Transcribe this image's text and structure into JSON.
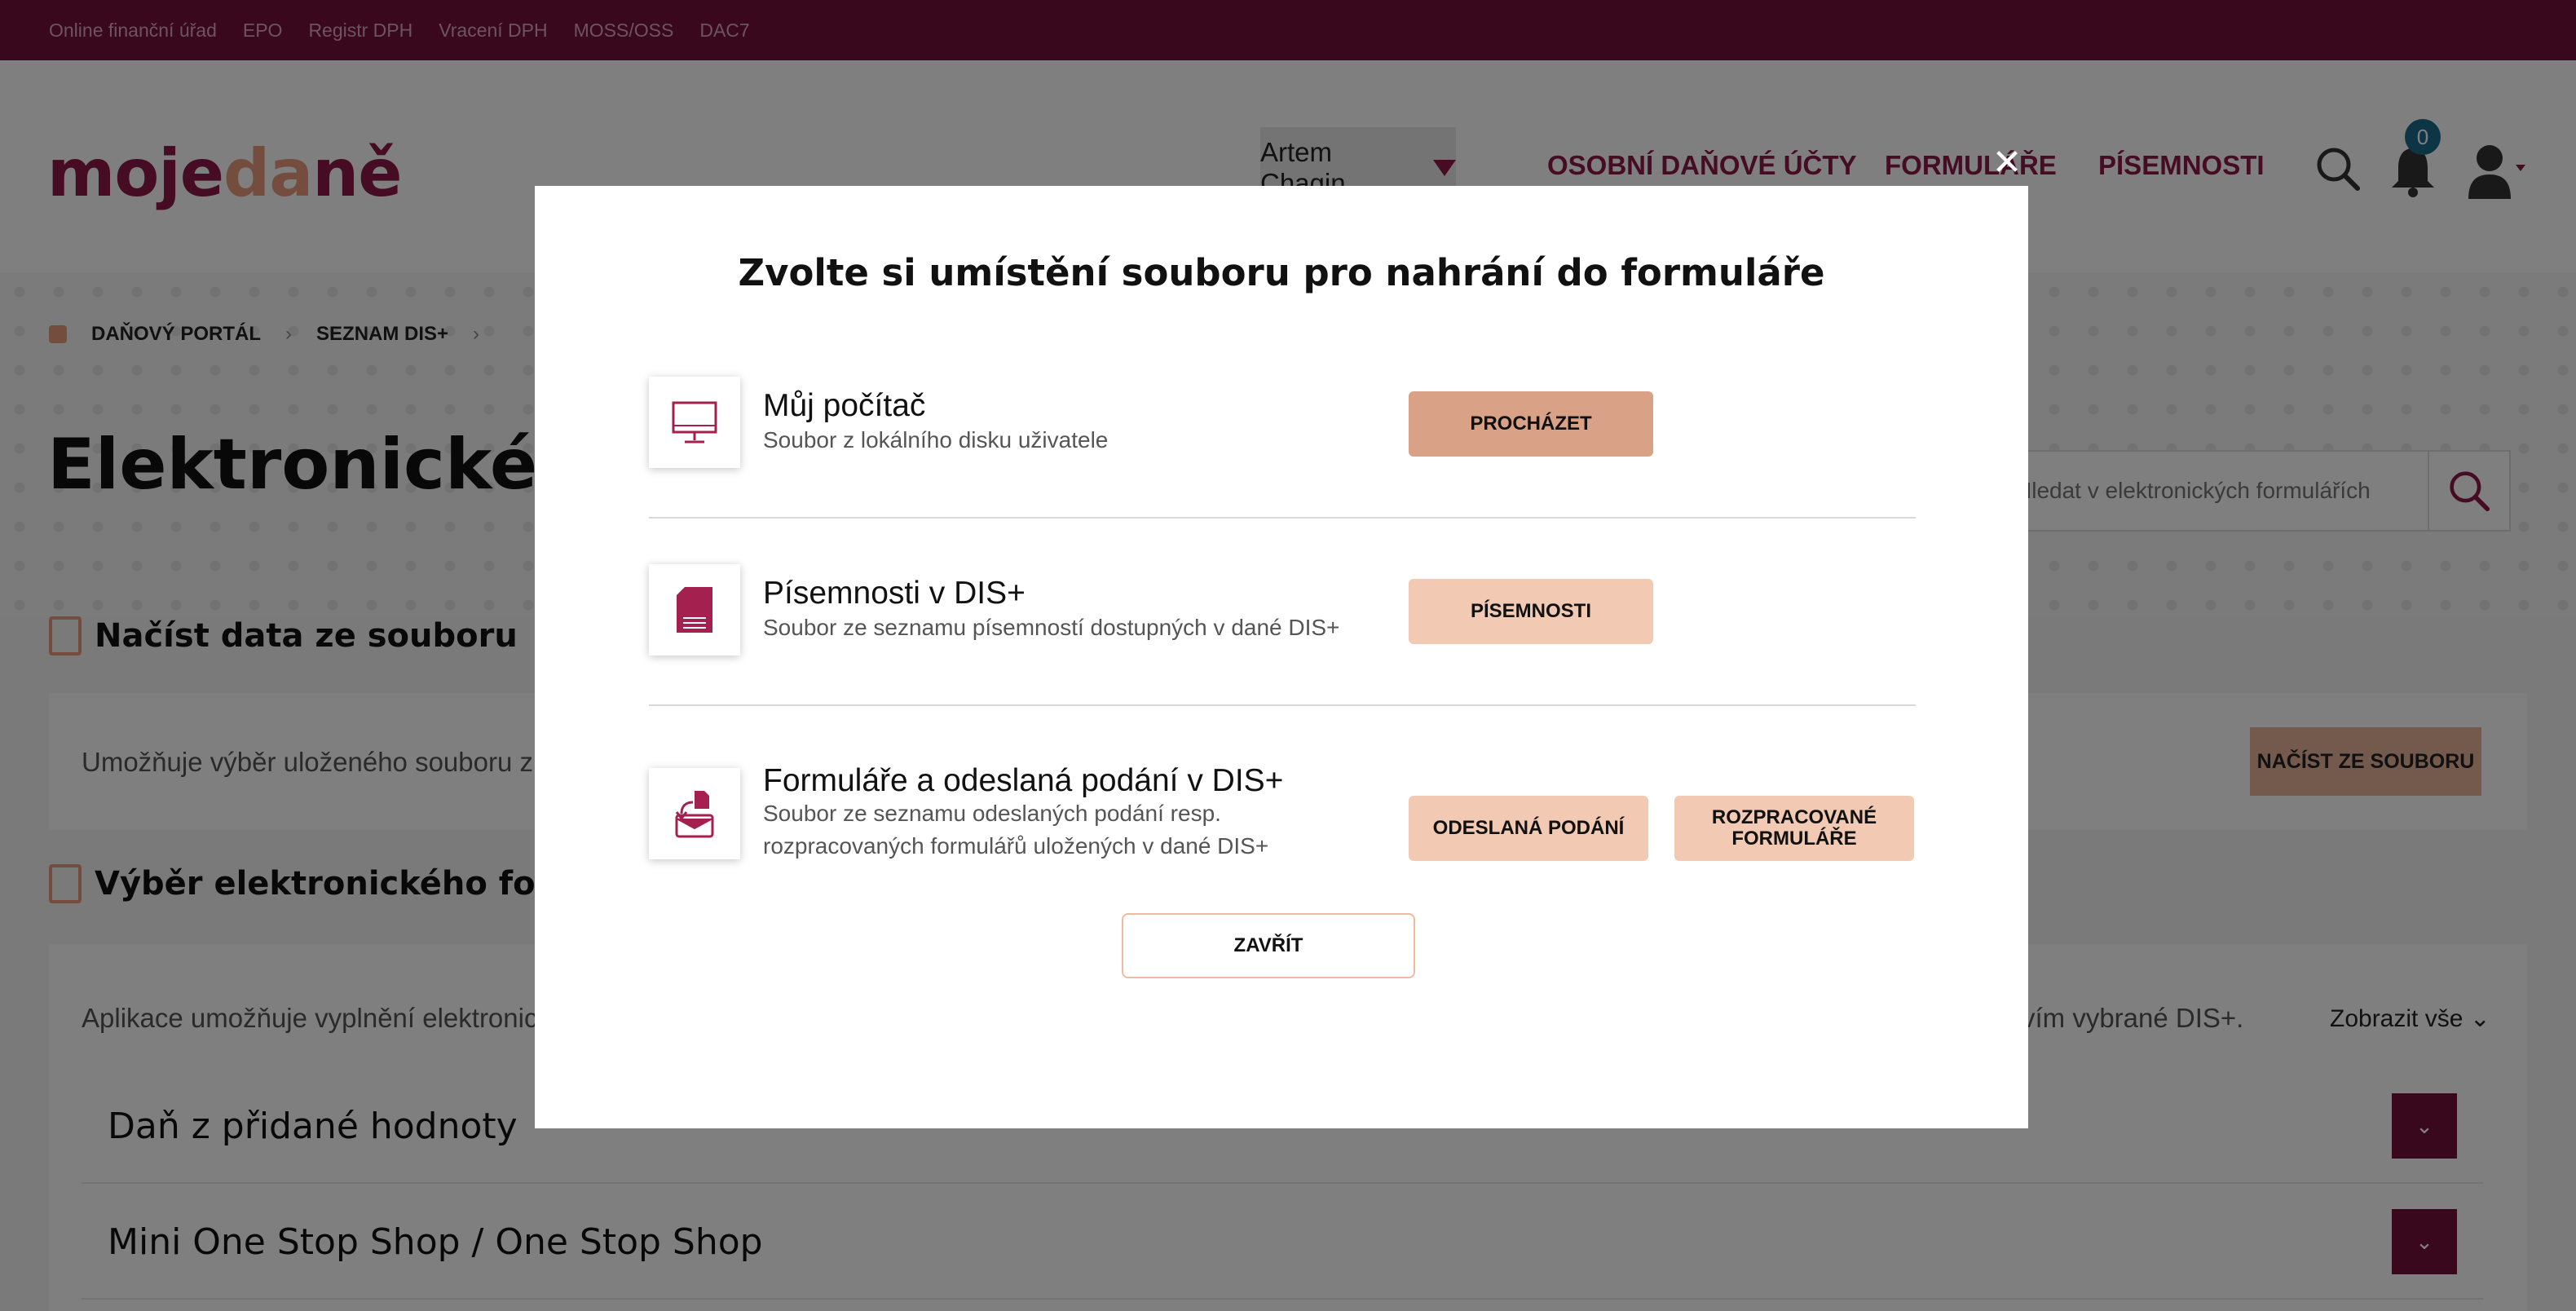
{
  "topbar": {
    "links": [
      "Online finanční úřad",
      "EPO",
      "Registr DPH",
      "Vracení DPH",
      "MOSS/OSS",
      "DAC7"
    ]
  },
  "header": {
    "logo": {
      "part1": "moje",
      "part2": "da",
      "part3": "ně"
    },
    "user_name": "Artem Chagin",
    "nav": [
      "OSOBNÍ DAŇOVÉ ÚČTY",
      "FORMULÁŘE",
      "PÍSEMNOSTI"
    ],
    "notifications_count": "0"
  },
  "breadcrumb": {
    "items": [
      "DAŇOVÝ PORTÁL",
      "SEZNAM DIS+"
    ]
  },
  "page": {
    "title": "Elektronické for",
    "search_placeholder": "Hledat v elektronických formulářích",
    "load_section": {
      "heading": "Načíst data ze souboru",
      "text": "Umožňuje výběr uloženého souboru z",
      "button": "NAČÍST ZE SOUBORU"
    },
    "select_section": {
      "heading": "Výběr elektronického formul",
      "text_left": "Aplikace umožňuje vyplnění elektronic",
      "text_right": "vím vybrané DIS+.",
      "show_all": "Zobrazit vše"
    },
    "accordions": [
      "Daň z přidané hodnoty",
      "Mini One Stop Shop / One Stop Shop"
    ]
  },
  "modal": {
    "title": "Zvolte si umístění souboru pro nahrání do formuláře",
    "options": [
      {
        "title": "Můj počítač",
        "desc": "Soubor z lokálního disku uživatele",
        "icon": "monitor-icon"
      },
      {
        "title": "Písemnosti v DIS+",
        "desc": "Soubor ze seznamu písemností dostupných v dané DIS+",
        "icon": "document-icon"
      },
      {
        "title": "Formuláře a odeslaná podání v DIS+",
        "desc": "Soubor ze seznamu odeslaných podání resp. rozpracovaných formulářů uložených v dané DIS+",
        "icon": "inbox-upload-icon"
      }
    ],
    "buttons": {
      "browse": "PROCHÁZET",
      "documents": "PÍSEMNOSTI",
      "sent": "ODESLANÁ PODÁNÍ",
      "drafts": "ROZPRACOVANÉ FORMULÁŘE",
      "close": "ZAVŘÍT"
    }
  },
  "colors": {
    "brand": "#74103a",
    "accent": "#e89a7c",
    "button_primary": "#d9a287",
    "button_secondary": "#f2c9b3"
  }
}
